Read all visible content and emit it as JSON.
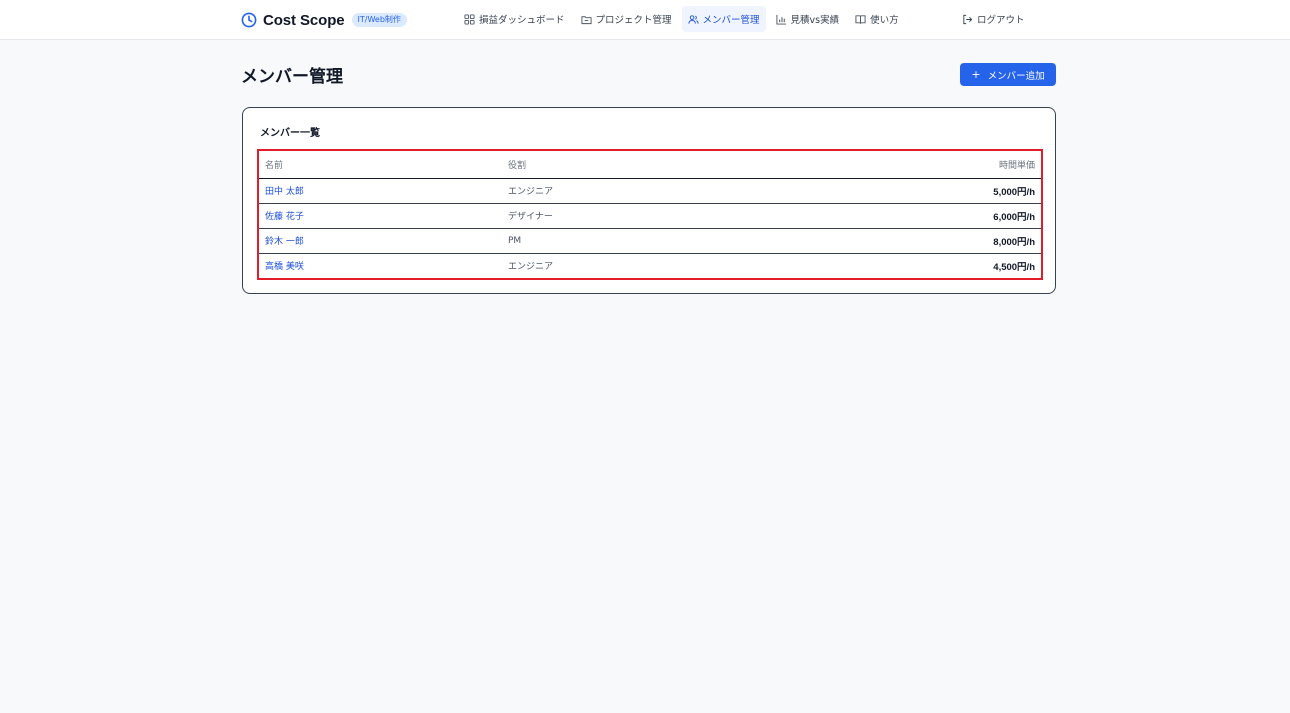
{
  "header": {
    "brand_name": "Cost Scope",
    "brand_badge": "IT/Web制作",
    "nav": [
      {
        "label": "損益ダッシュボード",
        "icon": "dashboard-grid-icon",
        "active": false
      },
      {
        "label": "プロジェクト管理",
        "icon": "folder-icon",
        "active": false
      },
      {
        "label": "メンバー管理",
        "icon": "users-icon",
        "active": true
      },
      {
        "label": "見積vs実績",
        "icon": "bar-chart-icon",
        "active": false
      },
      {
        "label": "使い方",
        "icon": "book-icon",
        "active": false
      }
    ],
    "logout_label": "ログアウト"
  },
  "page": {
    "title": "メンバー管理",
    "add_button_label": "メンバー追加"
  },
  "card": {
    "title": "メンバー一覧",
    "columns": [
      "名前",
      "役割",
      "時間単価"
    ],
    "rows": [
      {
        "name": "田中 太郎",
        "role": "エンジニア",
        "rate": "5,000円/h"
      },
      {
        "name": "佐藤 花子",
        "role": "デザイナー",
        "rate": "6,000円/h"
      },
      {
        "name": "鈴木 一郎",
        "role": "PM",
        "rate": "8,000円/h"
      },
      {
        "name": "高橋 美咲",
        "role": "エンジニア",
        "rate": "4,500円/h"
      }
    ]
  },
  "colors": {
    "accent": "#2563eb",
    "highlight_border": "#e11d2a",
    "background": "#f8f9fb"
  }
}
